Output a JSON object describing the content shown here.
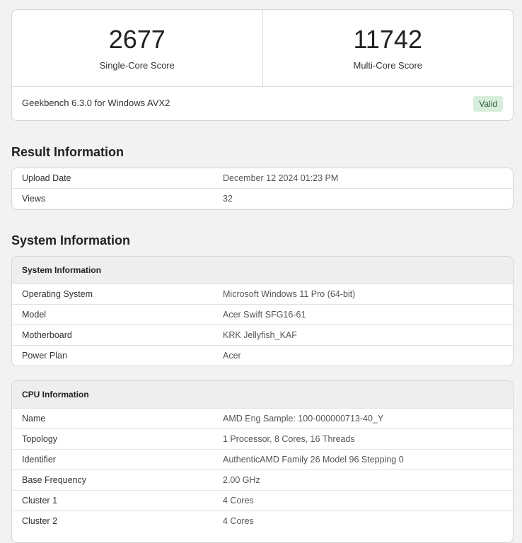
{
  "scores": {
    "single_core": {
      "value": "2677",
      "label": "Single-Core Score"
    },
    "multi_core": {
      "value": "11742",
      "label": "Multi-Core Score"
    }
  },
  "version": {
    "text": "Geekbench 6.3.0 for Windows AVX2",
    "status": "Valid"
  },
  "result_information": {
    "heading": "Result Information",
    "rows": [
      {
        "key": "Upload Date",
        "value": "December 12 2024 01:23 PM"
      },
      {
        "key": "Views",
        "value": "32"
      }
    ]
  },
  "system_information": {
    "heading": "System Information",
    "system_table": {
      "title": "System Information",
      "rows": [
        {
          "key": "Operating System",
          "value": "Microsoft Windows 11 Pro (64-bit)"
        },
        {
          "key": "Model",
          "value": "Acer Swift SFG16-61"
        },
        {
          "key": "Motherboard",
          "value": "KRK Jellyfish_KAF"
        },
        {
          "key": "Power Plan",
          "value": "Acer"
        }
      ]
    },
    "cpu_table": {
      "title": "CPU Information",
      "rows": [
        {
          "key": "Name",
          "value": "AMD Eng Sample: 100-000000713-40_Y"
        },
        {
          "key": "Topology",
          "value": "1 Processor, 8 Cores, 16 Threads"
        },
        {
          "key": "Identifier",
          "value": "AuthenticAMD Family 26 Model 96 Stepping 0"
        },
        {
          "key": "Base Frequency",
          "value": "2.00 GHz"
        },
        {
          "key": "Cluster 1",
          "value": "4 Cores"
        },
        {
          "key": "Cluster 2",
          "value": "4 Cores"
        }
      ]
    }
  },
  "colors": {
    "page_background": "#f2f2f2",
    "card_background": "#ffffff",
    "valid_badge_background": "#d8eedc",
    "valid_badge_text": "#2f5e3a"
  }
}
